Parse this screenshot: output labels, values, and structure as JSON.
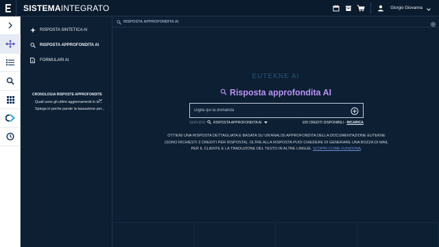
{
  "topbar": {
    "brand_part1": "SISTEMA",
    "brand_part2": "INTEGRATO",
    "user_name": "Giorgio Giovanna",
    "icons": [
      "calendar-icon",
      "archive-icon",
      "cart-icon",
      "user-icon",
      "chevron-down-icon"
    ]
  },
  "rail": {
    "items": [
      "chevron-right-icon",
      "arrows-move-icon",
      "list-icon",
      "search-icon",
      "grid-icon",
      "ck-logo-icon",
      "clock-icon"
    ]
  },
  "side": {
    "items": [
      {
        "label": "RISPOSTA SINTETICA AI",
        "icon": "sparkle-icon"
      },
      {
        "label": "RISPOSTA APPROFONDITA AI",
        "icon": "search-icon"
      },
      {
        "label": "FORMULARI AI",
        "icon": "document-icon"
      }
    ],
    "history_title": "CRONOLOGIA RISPOSTE APPROFONDITE",
    "history": [
      "Quali sono gli ultimi aggiornamenti in te...",
      "Spiega in poche parole la tassazione per..."
    ]
  },
  "main": {
    "breadcrumb": "RISPOSTA APPROFONDITA AI",
    "ek_title": "EUTEKNE AI",
    "ai_title": "Risposta approfondita AI",
    "ask_placeholder": "Digita qui la domanda",
    "service_label": "SERVIZIO:",
    "service_value": "RISPOSTA APPROFONDITA AI",
    "credits_text": "100 CREDITI DISPONIBILI - ",
    "credits_link": "RICARICA",
    "desc_text": "OTTIENI UNA RISPOSTA DETTAGLIATA E BASATA SU UN'ANALISI APPROFONDITA DELLA DOCUMENTAZIONE EUTEKNE (SONO RICHIESTI 3 CREDITI PER RISPOSTA). OLTRE ALLA RISPOSTA PUOI CHIEDERE DI GENERARE UNA BOZZA DI MAIL PER IL CLIENTE E LA TRADUZIONE DEL TESTO IN ALTRE LINGUE. ",
    "desc_link": "SCOPRI COME FUNZIONA",
    "desc_end": "."
  },
  "colors": {
    "background": "#0d1f33",
    "accent_purple": "#b892f3",
    "link_blue": "#6f8fd8",
    "rail_icon": "#16395f"
  }
}
